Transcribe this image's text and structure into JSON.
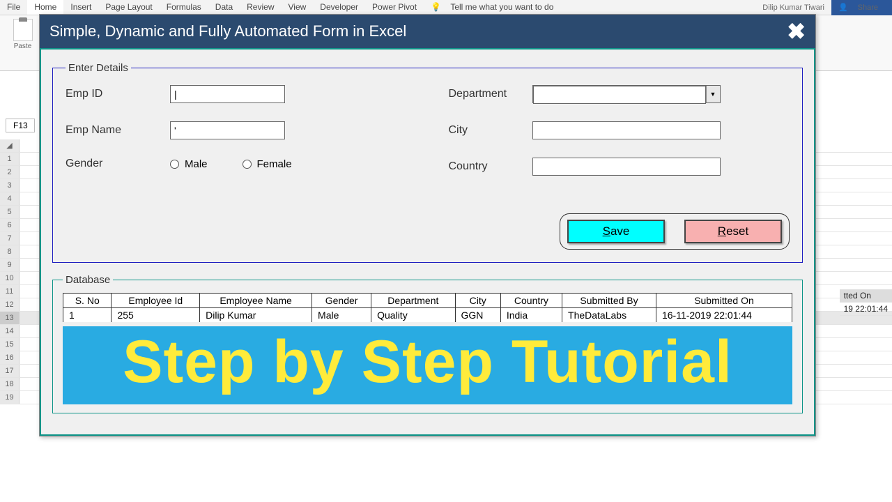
{
  "ribbon": {
    "tabs": [
      "File",
      "Home",
      "Insert",
      "Page Layout",
      "Formulas",
      "Data",
      "Review",
      "View",
      "Developer",
      "Power Pivot"
    ],
    "tellme": "Tell me what you want to do",
    "user": "Dilip Kumar Tiwari",
    "share": "Share",
    "paste": "Paste"
  },
  "cell_ref": "F13",
  "bg_cells": {
    "header_partial": "tted On",
    "timestamp_partial": "19 22:01:44"
  },
  "form": {
    "title": "Simple, Dynamic and Fully Automated Form in Excel",
    "legend": "Enter Details",
    "labels": {
      "emp_id": "Emp ID",
      "emp_name": "Emp Name",
      "gender": "Gender",
      "department": "Department",
      "city": "City",
      "country": "Country"
    },
    "radio": {
      "male": "Male",
      "female": "Female"
    },
    "values": {
      "emp_id": "|",
      "emp_name": "'",
      "department": "",
      "city": "",
      "country": ""
    },
    "buttons": {
      "save": "ave",
      "save_u": "S",
      "reset": "eset",
      "reset_u": "R"
    }
  },
  "database": {
    "legend": "Database",
    "headers": [
      "S. No",
      "Employee Id",
      "Employee Name",
      "Gender",
      "Department",
      "City",
      "Country",
      "Submitted By",
      "Submitted On"
    ],
    "row": [
      "1",
      "255",
      "Dilip Kumar",
      "Male",
      "Quality",
      "GGN",
      "India",
      "TheDataLabs",
      "16-11-2019 22:01:44"
    ]
  },
  "banner": "Step by Step Tutorial"
}
